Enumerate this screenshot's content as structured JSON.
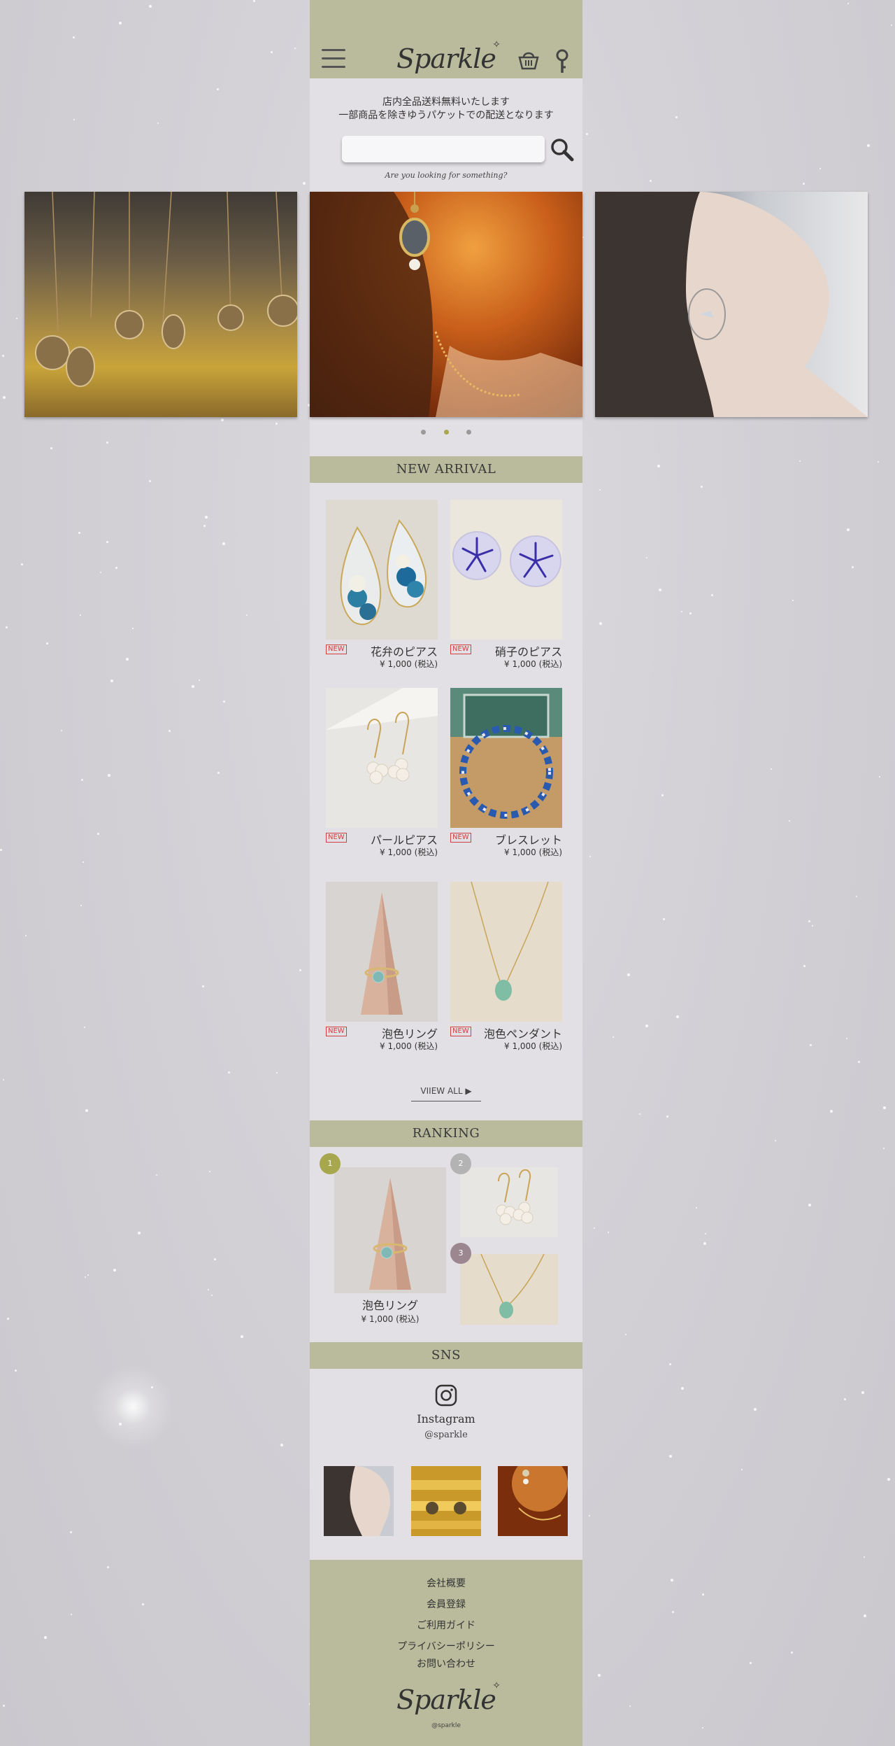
{
  "header": {
    "logo": "Sparkle",
    "logo_star": "✧"
  },
  "notice": {
    "line1": "店内全品送料無料いたします",
    "line2": "一部商品を除きゆうパケットでの配送となります"
  },
  "search": {
    "placeholder": "",
    "hint": "Are you looking for something?"
  },
  "slider": {
    "dot_count": 3,
    "active_dot": 2
  },
  "new_arrival": {
    "title": "NEW ARRIVAL",
    "badge": "NEW",
    "products": [
      {
        "name": "花弁のピアス",
        "price": "¥ 1,000 (税込)"
      },
      {
        "name": "硝子のピアス",
        "price": "¥ 1,000 (税込)"
      },
      {
        "name": "パールピアス",
        "price": "¥ 1,000 (税込)"
      },
      {
        "name": "ブレスレット",
        "price": "¥ 1,000 (税込)"
      },
      {
        "name": "泡色リング",
        "price": "¥ 1,000 (税込)"
      },
      {
        "name": "泡色ペンダント",
        "price": "¥ 1,000 (税込)"
      }
    ],
    "view_all": "VIIEW ALL ▶"
  },
  "ranking": {
    "title": "RANKING",
    "ranks": [
      {
        "rank": "1",
        "color": "#a7a74e",
        "name": "泡色リング",
        "price": "¥ 1,000 (税込)"
      },
      {
        "rank": "2",
        "color": "#b3b3b3"
      },
      {
        "rank": "3",
        "color": "#9c8790"
      }
    ]
  },
  "sns": {
    "title": "SNS",
    "label": "Instagram",
    "handle": "@sparkle"
  },
  "footer": {
    "links": [
      "会社概要",
      "会員登録",
      "ご利用ガイド",
      "プライバシーポリシー",
      "お問い合わせ"
    ],
    "logo": "Sparkle",
    "logo_star": "✧",
    "handle": "@sparkle"
  },
  "colors": {
    "accent": "#b9bb9c",
    "column_bg": "#e2e0e4",
    "new_badge": "#d04040"
  }
}
